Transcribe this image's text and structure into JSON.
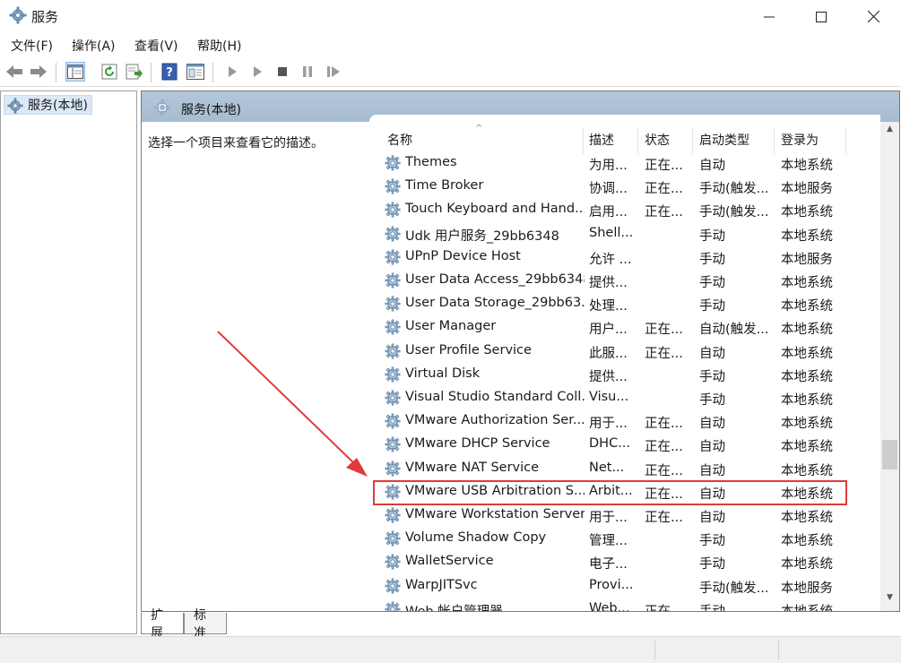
{
  "window": {
    "title": "服务",
    "icons": {
      "app": "gear-icon",
      "minimize": "minimize-icon",
      "maximize": "maximize-icon",
      "close": "close-icon"
    }
  },
  "menu": [
    "文件(F)",
    "操作(A)",
    "查看(V)",
    "帮助(H)"
  ],
  "toolbar": {
    "buttons": [
      "back-icon",
      "forward-icon",
      "show-hide-tree-icon",
      "refresh-icon",
      "export-list-icon",
      "help-icon",
      "properties-icon",
      "start-icon",
      "start-alt-icon",
      "stop-icon",
      "pause-icon",
      "restart-icon"
    ]
  },
  "tree": {
    "root_label": "服务(本地)"
  },
  "pane": {
    "header": "服务(本地)",
    "description_prompt": "选择一个项目来查看它的描述。"
  },
  "columns": {
    "name": "名称",
    "desc": "描述",
    "status": "状态",
    "startup": "启动类型",
    "logon": "登录为"
  },
  "services": [
    {
      "name": "Themes",
      "desc": "为用...",
      "status": "正在...",
      "startup": "自动",
      "logon": "本地系统"
    },
    {
      "name": "Time Broker",
      "desc": "协调...",
      "status": "正在...",
      "startup": "手动(触发...",
      "logon": "本地服务"
    },
    {
      "name": "Touch Keyboard and Hand...",
      "desc": "启用...",
      "status": "正在...",
      "startup": "手动(触发...",
      "logon": "本地系统"
    },
    {
      "name": "Udk 用户服务_29bb6348",
      "desc": "Shell...",
      "status": "",
      "startup": "手动",
      "logon": "本地系统"
    },
    {
      "name": "UPnP Device Host",
      "desc": "允许 ...",
      "status": "",
      "startup": "手动",
      "logon": "本地服务"
    },
    {
      "name": "User Data Access_29bb6348",
      "desc": "提供...",
      "status": "",
      "startup": "手动",
      "logon": "本地系统"
    },
    {
      "name": "User Data Storage_29bb63...",
      "desc": "处理...",
      "status": "",
      "startup": "手动",
      "logon": "本地系统"
    },
    {
      "name": "User Manager",
      "desc": "用户...",
      "status": "正在...",
      "startup": "自动(触发...",
      "logon": "本地系统"
    },
    {
      "name": "User Profile Service",
      "desc": "此服...",
      "status": "正在...",
      "startup": "自动",
      "logon": "本地系统"
    },
    {
      "name": "Virtual Disk",
      "desc": "提供...",
      "status": "",
      "startup": "手动",
      "logon": "本地系统"
    },
    {
      "name": "Visual Studio Standard Coll...",
      "desc": "Visu...",
      "status": "",
      "startup": "手动",
      "logon": "本地系统"
    },
    {
      "name": "VMware Authorization Ser...",
      "desc": "用于...",
      "status": "正在...",
      "startup": "自动",
      "logon": "本地系统"
    },
    {
      "name": "VMware DHCP Service",
      "desc": "DHC...",
      "status": "正在...",
      "startup": "自动",
      "logon": "本地系统"
    },
    {
      "name": "VMware NAT Service",
      "desc": "Net...",
      "status": "正在...",
      "startup": "自动",
      "logon": "本地系统"
    },
    {
      "name": "VMware USB Arbitration S...",
      "desc": "Arbit...",
      "status": "正在...",
      "startup": "自动",
      "logon": "本地系统"
    },
    {
      "name": "VMware Workstation Server",
      "desc": "用于...",
      "status": "正在...",
      "startup": "自动",
      "logon": "本地系统"
    },
    {
      "name": "Volume Shadow Copy",
      "desc": "管理...",
      "status": "",
      "startup": "手动",
      "logon": "本地系统"
    },
    {
      "name": "WalletService",
      "desc": "电子...",
      "status": "",
      "startup": "手动",
      "logon": "本地系统"
    },
    {
      "name": "WarpJITSvc",
      "desc": "Provi...",
      "status": "",
      "startup": "手动(触发...",
      "logon": "本地服务"
    },
    {
      "name": "Web 帐户管理器",
      "desc": "Web...",
      "status": "正在...",
      "startup": "手动",
      "logon": "本地系统"
    }
  ],
  "tabs": [
    "扩展",
    "标准"
  ],
  "annotation": {
    "highlight_color": "#e03a3a",
    "highlighted_service": "VMware USB Arbitration S..."
  }
}
